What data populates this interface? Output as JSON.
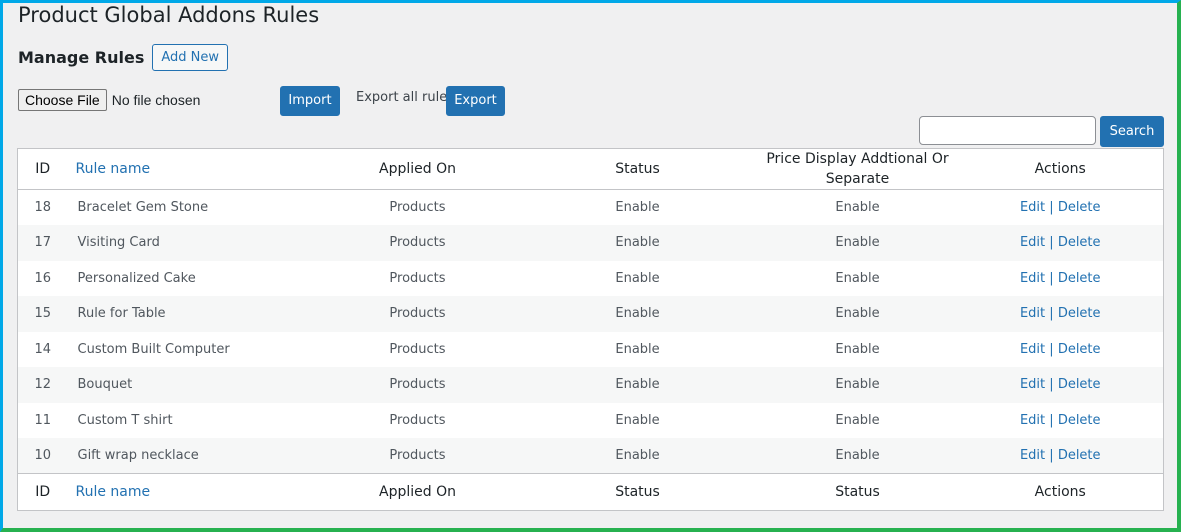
{
  "page": {
    "title": "Product Global Addons Rules",
    "manage_title": "Manage Rules",
    "add_new_label": "Add New"
  },
  "import": {
    "choose_file_label": "Choose File",
    "file_status": "No file chosen",
    "import_label": "Import"
  },
  "export": {
    "description": "Export all rules.",
    "export_label": "Export"
  },
  "search": {
    "value": "",
    "button_label": "Search"
  },
  "table": {
    "header": {
      "id": "ID",
      "rule_name": "Rule name",
      "applied_on": "Applied On",
      "status": "Status",
      "price_display": "Price Display Addtional Or Separate",
      "actions": "Actions"
    },
    "footer": {
      "id": "ID",
      "rule_name": "Rule name",
      "applied_on": "Applied On",
      "status": "Status",
      "price_display": "Status",
      "actions": "Actions"
    },
    "rows": [
      {
        "id": "18",
        "name": "Bracelet Gem Stone",
        "applied_on": "Products",
        "status": "Enable",
        "price_display": "Enable",
        "edit": "Edit",
        "separator": "|",
        "delete": "Delete"
      },
      {
        "id": "17",
        "name": "Visiting Card",
        "applied_on": "Products",
        "status": "Enable",
        "price_display": "Enable",
        "edit": "Edit",
        "separator": "|",
        "delete": "Delete"
      },
      {
        "id": "16",
        "name": "Personalized Cake",
        "applied_on": "Products",
        "status": "Enable",
        "price_display": "Enable",
        "edit": "Edit",
        "separator": "|",
        "delete": "Delete"
      },
      {
        "id": "15",
        "name": "Rule for Table",
        "applied_on": "Products",
        "status": "Enable",
        "price_display": "Enable",
        "edit": "Edit",
        "separator": "|",
        "delete": "Delete"
      },
      {
        "id": "14",
        "name": "Custom Built Computer",
        "applied_on": "Products",
        "status": "Enable",
        "price_display": "Enable",
        "edit": "Edit",
        "separator": "|",
        "delete": "Delete"
      },
      {
        "id": "12",
        "name": "Bouquet",
        "applied_on": "Products",
        "status": "Enable",
        "price_display": "Enable",
        "edit": "Edit",
        "separator": "|",
        "delete": "Delete"
      },
      {
        "id": "11",
        "name": "Custom T shirt",
        "applied_on": "Products",
        "status": "Enable",
        "price_display": "Enable",
        "edit": "Edit",
        "separator": "|",
        "delete": "Delete"
      },
      {
        "id": "10",
        "name": "Gift wrap necklace",
        "applied_on": "Products",
        "status": "Enable",
        "price_display": "Enable",
        "edit": "Edit",
        "separator": "|",
        "delete": "Delete"
      }
    ]
  },
  "colors": {
    "link": "#2271b1",
    "primary_button": "#2271b1",
    "frame_top_left": "#00a8e8",
    "frame_bottom_right": "#27b150"
  }
}
